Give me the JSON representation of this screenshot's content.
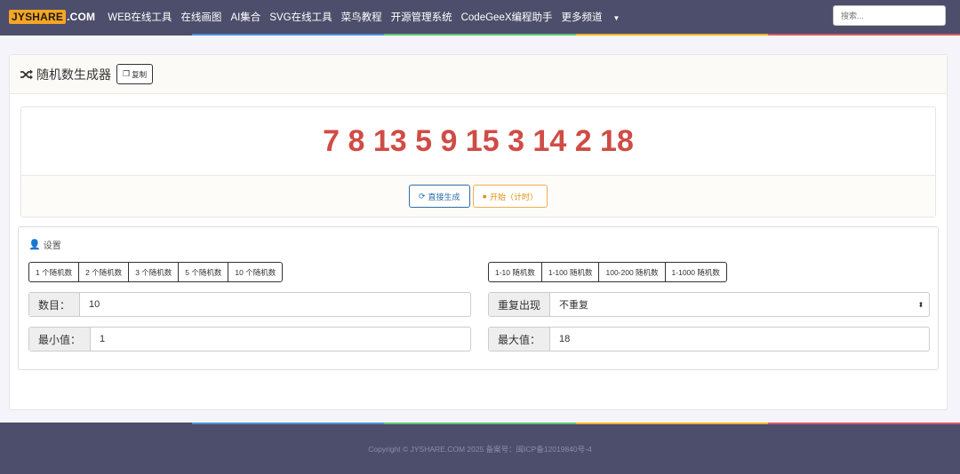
{
  "navbar": {
    "brand_part1": "JYSHARE",
    "brand_part2": ".COM",
    "items": [
      "WEB在线工具",
      "在线画图",
      "AI集合",
      "SVG在线工具",
      "菜鸟教程",
      "开源管理系统",
      "CodeGeeX编程助手",
      "更多频道"
    ],
    "search_placeholder": "搜索..."
  },
  "panel": {
    "title": "随机数生成器",
    "copy_label": "复制",
    "result": "7 8 13 5 9 15 3 14 2 18",
    "generate_label": "直接生成",
    "start_label": "开始（计时）"
  },
  "settings": {
    "title": "设置",
    "count_buttons": [
      "1 个随机数",
      "2 个随机数",
      "3 个随机数",
      "5 个随机数",
      "10 个随机数"
    ],
    "range_buttons": [
      "1-10 随机数",
      "1-100 随机数",
      "100-200 随机数",
      "1-1000 随机数"
    ],
    "count_label": "数目：",
    "count_value": "10",
    "repeat_label": "重复出现",
    "repeat_value": "不重复",
    "min_label": "最小值：",
    "min_value": "1",
    "max_label": "最大值：",
    "max_value": "18"
  },
  "footer": {
    "copyright": "Copyright © JYSHARE.COM 2025 备案号：闽ICP备12019840号-4"
  },
  "colors": {
    "navbar_bg": "#4d4e6b",
    "brand_accent": "#f6a623",
    "result_red": "#d04c45",
    "rainbow": [
      "#4d4e6b",
      "#4d8ed1",
      "#5ec47a",
      "#f0b323",
      "#d95763"
    ]
  }
}
